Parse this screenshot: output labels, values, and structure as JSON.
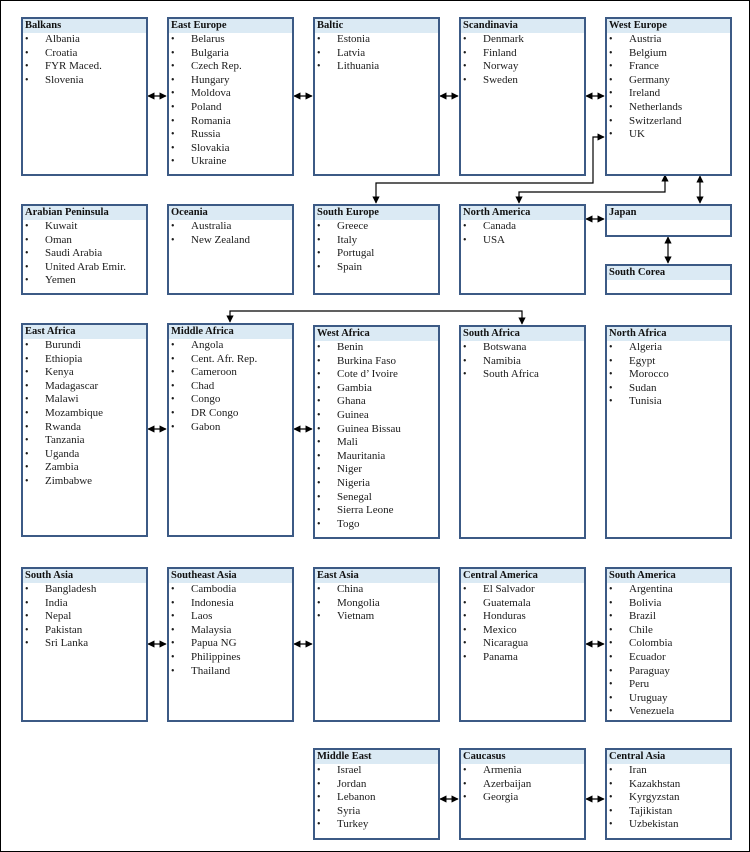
{
  "diagram": {
    "regions": [
      {
        "id": "balkans",
        "title": "Balkans",
        "countries": [
          "Albania",
          "Croatia",
          "FYR Maced.",
          "Slovenia"
        ]
      },
      {
        "id": "east-europe",
        "title": "East Europe",
        "countries": [
          "Belarus",
          "Bulgaria",
          "Czech Rep.",
          "Hungary",
          "Moldova",
          "Poland",
          "Romania",
          "Russia",
          "Slovakia",
          "Ukraine"
        ]
      },
      {
        "id": "baltic",
        "title": "Baltic",
        "countries": [
          "Estonia",
          "Latvia",
          "Lithuania"
        ]
      },
      {
        "id": "scandinavia",
        "title": "Scandinavia",
        "countries": [
          "Denmark",
          "Finland",
          "Norway",
          "Sweden"
        ]
      },
      {
        "id": "west-europe",
        "title": "West Europe",
        "countries": [
          "Austria",
          "Belgium",
          "France",
          "Germany",
          "Ireland",
          "Netherlands",
          "Switzerland",
          "UK"
        ]
      },
      {
        "id": "arabian-peninsula",
        "title": "Arabian Peninsula",
        "countries": [
          "Kuwait",
          "Oman",
          "Saudi Arabia",
          "United Arab Emir.",
          "Yemen"
        ]
      },
      {
        "id": "oceania",
        "title": "Oceania",
        "countries": [
          "Australia",
          "New Zealand"
        ]
      },
      {
        "id": "south-europe",
        "title": "South Europe",
        "countries": [
          "Greece",
          "Italy",
          "Portugal",
          "Spain"
        ]
      },
      {
        "id": "north-america",
        "title": "North America",
        "countries": [
          "Canada",
          "USA"
        ]
      },
      {
        "id": "japan",
        "title": "Japan",
        "countries": []
      },
      {
        "id": "south-corea",
        "title": "South Corea",
        "countries": []
      },
      {
        "id": "east-africa",
        "title": "East Africa",
        "countries": [
          "Burundi",
          "Ethiopia",
          "Kenya",
          "Madagascar",
          "Malawi",
          "Mozambique",
          "Rwanda",
          "Tanzania",
          "Uganda",
          "Zambia",
          "Zimbabwe"
        ]
      },
      {
        "id": "middle-africa",
        "title": "Middle Africa",
        "countries": [
          "Angola",
          "Cent. Afr. Rep.",
          "Cameroon",
          "Chad",
          "Congo",
          "DR Congo",
          "Gabon"
        ]
      },
      {
        "id": "west-africa",
        "title": "West Africa",
        "countries": [
          "Benin",
          "Burkina Faso",
          "Cote d’ Ivoire",
          "Gambia",
          "Ghana",
          "Guinea",
          "Guinea Bissau",
          "Mali",
          "Mauritania",
          "Niger",
          "Nigeria",
          "Senegal",
          "Sierra Leone",
          "Togo"
        ]
      },
      {
        "id": "south-africa",
        "title": "South Africa",
        "countries": [
          "Botswana",
          "Namibia",
          "South Africa"
        ]
      },
      {
        "id": "north-africa",
        "title": "North Africa",
        "countries": [
          "Algeria",
          "Egypt",
          "Morocco",
          "Sudan",
          "Tunisia"
        ]
      },
      {
        "id": "south-asia",
        "title": "South Asia",
        "countries": [
          "Bangladesh",
          "India",
          "Nepal",
          "Pakistan",
          "Sri Lanka"
        ]
      },
      {
        "id": "southeast-asia",
        "title": "Southeast Asia",
        "countries": [
          "Cambodia",
          "Indonesia",
          "Laos",
          "Malaysia",
          "Papua NG",
          "Philippines",
          "Thailand"
        ]
      },
      {
        "id": "east-asia",
        "title": "East Asia",
        "countries": [
          "China",
          "Mongolia",
          "Vietnam"
        ]
      },
      {
        "id": "central-america",
        "title": "Central America",
        "countries": [
          "El Salvador",
          "Guatemala",
          "Honduras",
          "Mexico",
          "Nicaragua",
          "Panama"
        ]
      },
      {
        "id": "south-america",
        "title": "South America",
        "countries": [
          "Argentina",
          "Bolivia",
          "Brazil",
          "Chile",
          "Colombia",
          "Ecuador",
          "Paraguay",
          "Peru",
          "Uruguay",
          "Venezuela"
        ]
      },
      {
        "id": "middle-east",
        "title": "Middle East",
        "countries": [
          "Israel",
          "Jordan",
          "Lebanon",
          "Syria",
          "Turkey"
        ]
      },
      {
        "id": "caucasus",
        "title": "Caucasus",
        "countries": [
          "Armenia",
          "Azerbaijan",
          "Georgia"
        ]
      },
      {
        "id": "central-asia",
        "title": "Central Asia",
        "countries": [
          "Iran",
          "Kazakhstan",
          "Kyrgyzstan",
          "Tajikistan",
          "Uzbekistan"
        ]
      }
    ],
    "links": [
      {
        "from": "balkans",
        "to": "east-europe",
        "type": "bidirectional"
      },
      {
        "from": "east-europe",
        "to": "baltic",
        "type": "bidirectional"
      },
      {
        "from": "baltic",
        "to": "scandinavia",
        "type": "bidirectional"
      },
      {
        "from": "scandinavia",
        "to": "west-europe",
        "type": "bidirectional"
      },
      {
        "from": "south-europe",
        "to": "west-europe",
        "type": "bidirectional"
      },
      {
        "from": "north-america",
        "to": "west-europe",
        "type": "bidirectional"
      },
      {
        "from": "west-europe",
        "to": "japan",
        "type": "bidirectional"
      },
      {
        "from": "north-america",
        "to": "japan",
        "type": "bidirectional"
      },
      {
        "from": "japan",
        "to": "south-corea",
        "type": "bidirectional"
      },
      {
        "from": "east-africa",
        "to": "middle-africa",
        "type": "bidirectional"
      },
      {
        "from": "middle-africa",
        "to": "west-africa",
        "type": "bidirectional"
      },
      {
        "from": "middle-africa",
        "to": "south-africa",
        "type": "bidirectional"
      },
      {
        "from": "south-asia",
        "to": "southeast-asia",
        "type": "bidirectional"
      },
      {
        "from": "southeast-asia",
        "to": "east-asia",
        "type": "bidirectional"
      },
      {
        "from": "central-america",
        "to": "south-america",
        "type": "bidirectional"
      },
      {
        "from": "middle-east",
        "to": "caucasus",
        "type": "bidirectional"
      },
      {
        "from": "caucasus",
        "to": "central-asia",
        "type": "bidirectional"
      }
    ]
  }
}
